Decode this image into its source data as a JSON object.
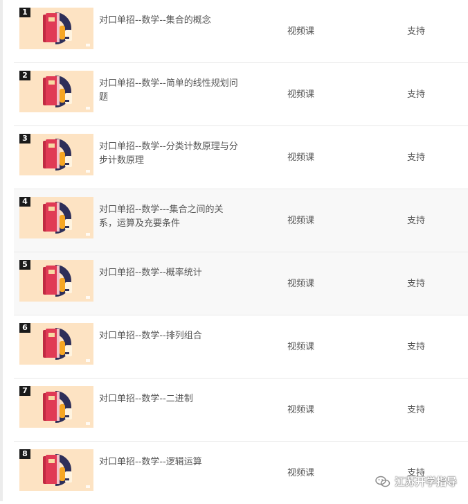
{
  "courses": [
    {
      "num": "1",
      "title": "对口单招--数学--集合的概念",
      "type": "视频课",
      "support": "支持"
    },
    {
      "num": "2",
      "title": "对口单招--数学--简单的线性规划问题",
      "type": "视频课",
      "support": "支持"
    },
    {
      "num": "3",
      "title": "对口单招--数学--分类计数原理与分步计数原理",
      "type": "视频课",
      "support": "支持"
    },
    {
      "num": "4",
      "title": "对口单招--数学---集合之间的关系，运算及充要条件",
      "type": "视频课",
      "support": "支持"
    },
    {
      "num": "5",
      "title": "对口单招--数学--概率统计",
      "type": "视频课",
      "support": "支持"
    },
    {
      "num": "6",
      "title": "对口单招--数学--排列组合",
      "type": "视频课",
      "support": "支持"
    },
    {
      "num": "7",
      "title": "对口单招--数学--二进制",
      "type": "视频课",
      "support": "支持"
    },
    {
      "num": "8",
      "title": "对口单招--数学--逻辑运算",
      "type": "视频课",
      "support": "支持"
    }
  ],
  "watermark": {
    "text": "江苏开学指导",
    "icon": "wechat-icon"
  },
  "colors": {
    "thumb_bg": "#fde3c3",
    "book_red": "#d8344d",
    "ring_navy": "#2e2f59",
    "badge": "#1a1a1a"
  }
}
